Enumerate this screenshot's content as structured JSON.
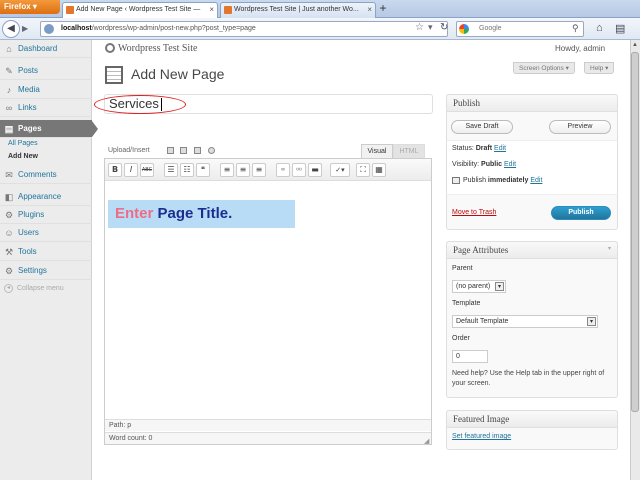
{
  "browser": {
    "app_button": "Firefox",
    "tabs": [
      {
        "label": "Add New Page ‹ Wordpress Test Site —",
        "active": true
      },
      {
        "label": "Wordpress Test Site | Just another Wo...",
        "active": false
      }
    ],
    "new_tab": "+",
    "url_host": "localhost",
    "url_path": "/wordpress/wp-admin/post-new.php?post_type=page",
    "search_placeholder": "Google"
  },
  "sidebar": {
    "items": [
      {
        "label": "Dashboard",
        "icon": "⌂"
      },
      {
        "label": "Posts",
        "icon": "✎"
      },
      {
        "label": "Media",
        "icon": "♪"
      },
      {
        "label": "Links",
        "icon": "∞"
      },
      {
        "label": "Pages",
        "icon": "▤"
      },
      {
        "label": "Comments",
        "icon": "✉"
      },
      {
        "label": "Appearance",
        "icon": "◧"
      },
      {
        "label": "Plugins",
        "icon": "⚙"
      },
      {
        "label": "Users",
        "icon": "☺"
      },
      {
        "label": "Tools",
        "icon": "⚒"
      },
      {
        "label": "Settings",
        "icon": "⚙"
      }
    ],
    "sub_items": [
      "All Pages",
      "Add New"
    ],
    "collapse": "Collapse menu"
  },
  "header": {
    "site_name": "Wordpress Test Site",
    "howdy": "Howdy, admin",
    "heading": "Add New Page",
    "screen_options": "Screen Options ▾",
    "help": "Help ▾"
  },
  "editor": {
    "title_value": "Services",
    "upload_insert": "Upload/Insert",
    "tab_visual": "Visual",
    "tab_html": "HTML",
    "toolbar": [
      "B",
      "I",
      "ABC",
      "☰",
      "☷",
      "❝",
      "≡",
      "≡",
      "≡",
      "⚭",
      "⚮",
      "▬",
      "✓▾",
      "⛶",
      "▦"
    ],
    "hint_enter": "Enter",
    "hint_rest": " Page Title.",
    "path": "Path: p",
    "word_count": "Word count: 0"
  },
  "publish": {
    "title": "Publish",
    "save_draft": "Save Draft",
    "preview": "Preview",
    "status_label": "Status: ",
    "status_value": "Draft",
    "edit": "Edit",
    "visibility_label": "Visibility: ",
    "visibility_value": "Public",
    "publish_label": "Publish ",
    "publish_value": "immediately",
    "trash": "Move to Trash",
    "publish_btn": "Publish"
  },
  "attributes": {
    "title": "Page Attributes",
    "parent_label": "Parent",
    "parent_value": "(no parent)",
    "template_label": "Template",
    "template_value": "Default Template",
    "order_label": "Order",
    "order_value": "0",
    "help_text": "Need help? Use the Help tab in the upper right of your screen."
  },
  "featured": {
    "title": "Featured Image",
    "link": "Set featured image"
  }
}
